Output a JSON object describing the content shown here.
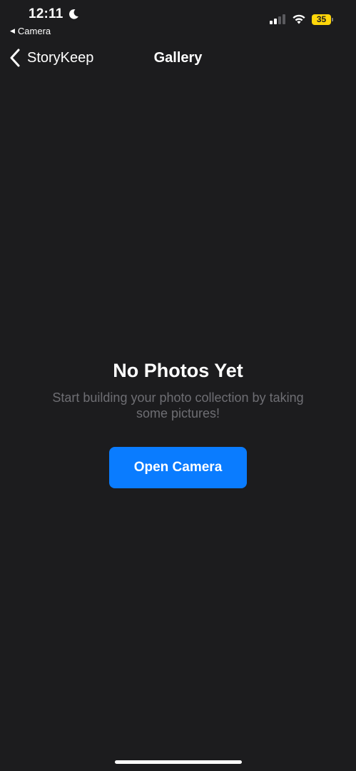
{
  "status_bar": {
    "time": "12:11",
    "return_app_label": "Camera",
    "battery_level": "35",
    "icons": [
      "moon-icon",
      "signal-icon",
      "wifi-icon",
      "battery-icon"
    ]
  },
  "nav": {
    "back_label": "StoryKeep",
    "title": "Gallery"
  },
  "empty_state": {
    "title": "No Photos Yet",
    "subtitle": "Start building your photo collection by taking some pictures!",
    "button_label": "Open Camera"
  },
  "colors": {
    "background": "#1c1c1e",
    "accent": "#0a7cff",
    "battery": "#ffd60a",
    "subtitle_text": "#6e6e73"
  }
}
